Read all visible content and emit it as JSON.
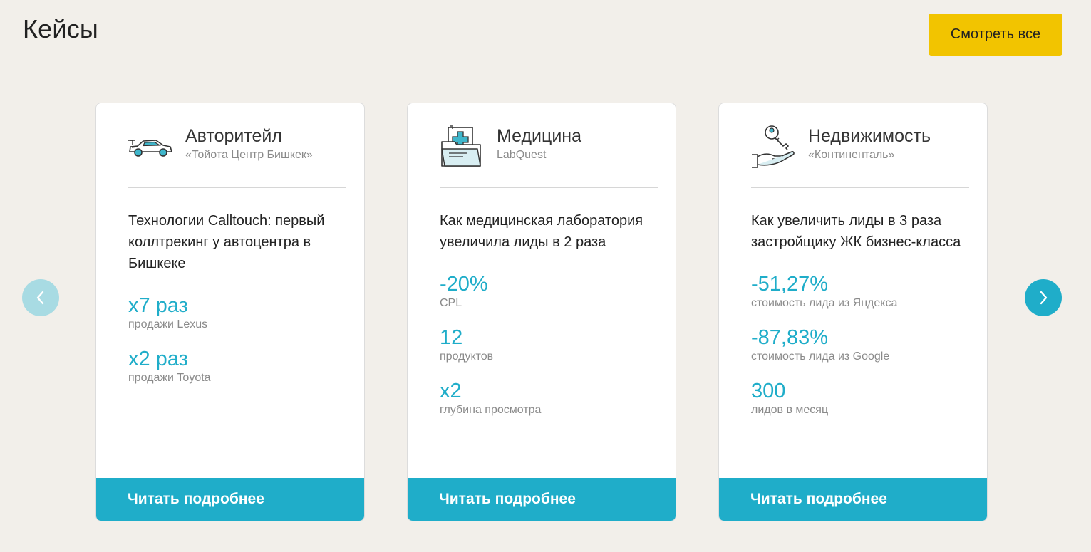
{
  "header": {
    "title": "Кейсы",
    "view_all_label": "Смотреть все"
  },
  "nav": {
    "prev_icon": "chevron-left-icon",
    "next_icon": "chevron-right-icon"
  },
  "colors": {
    "accent": "#1fadc9",
    "button_yellow": "#f2c400",
    "background": "#f2efea"
  },
  "cards": [
    {
      "icon": "car-icon",
      "category": "Авторитейл",
      "client": "«Тойота Центр Бишкек»",
      "headline": "Технологии Calltouch: первый коллтрекинг у автоцентра в Бишкеке",
      "metrics": [
        {
          "value": "х7 раз",
          "label": "продажи Lexus"
        },
        {
          "value": "х2 раз",
          "label": "продажи Toyota"
        }
      ],
      "cta": "Читать подробнее"
    },
    {
      "icon": "medical-folder-icon",
      "category": "Медицина",
      "client": "LabQuest",
      "headline": "Как медицинская лаборатория увеличила лиды в 2 раза",
      "metrics": [
        {
          "value": "-20%",
          "label": "CPL"
        },
        {
          "value": "12",
          "label": "продуктов"
        },
        {
          "value": "х2",
          "label": "глубина просмотра"
        }
      ],
      "cta": "Читать подробнее"
    },
    {
      "icon": "key-in-hand-icon",
      "category": "Недвижимость",
      "client": "«Континенталь»",
      "headline": "Как увеличить лиды в 3 раза застройщику ЖК бизнес-класса",
      "metrics": [
        {
          "value": "-51,27%",
          "label": "стоимость лида из Яндекса"
        },
        {
          "value": "-87,83%",
          "label": "стоимость лида из Google"
        },
        {
          "value": "300",
          "label": "лидов в месяц"
        }
      ],
      "cta": "Читать подробнее"
    }
  ]
}
